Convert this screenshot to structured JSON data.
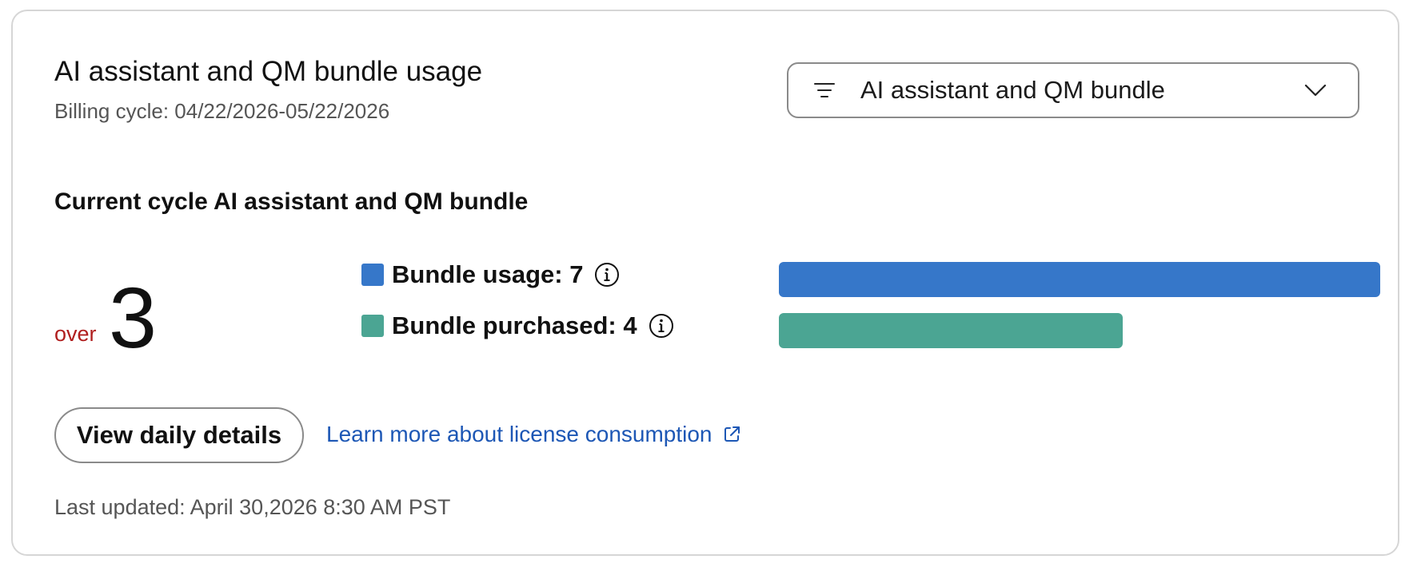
{
  "header": {
    "title": "AI assistant and QM bundle usage",
    "billing_cycle": "Billing cycle: 04/22/2026-05/22/2026"
  },
  "filter_dropdown": {
    "selected": "AI assistant and QM bundle",
    "icon": "filter-lines-icon"
  },
  "current_cycle": {
    "title": "Current cycle AI assistant and QM bundle",
    "over_label": "over",
    "over_value": "3"
  },
  "chart_data": {
    "type": "bar",
    "orientation": "horizontal",
    "categories": [
      "Bundle usage",
      "Bundle purchased"
    ],
    "values": [
      7,
      4
    ],
    "labels": [
      "Bundle usage: 7",
      "Bundle purchased: 4"
    ],
    "colors": [
      "#3677c9",
      "#4ba593"
    ],
    "xlim": [
      0,
      7
    ]
  },
  "actions": {
    "view_daily_details": "View daily details",
    "learn_more": "Learn more about license consumption"
  },
  "footer": {
    "last_updated": "Last updated: April 30,2026 8:30 AM PST"
  },
  "colors": {
    "over_text": "#b01e1e",
    "link": "#1d57b5",
    "usage_bar": "#3677c9",
    "purchased_bar": "#4ba593"
  }
}
